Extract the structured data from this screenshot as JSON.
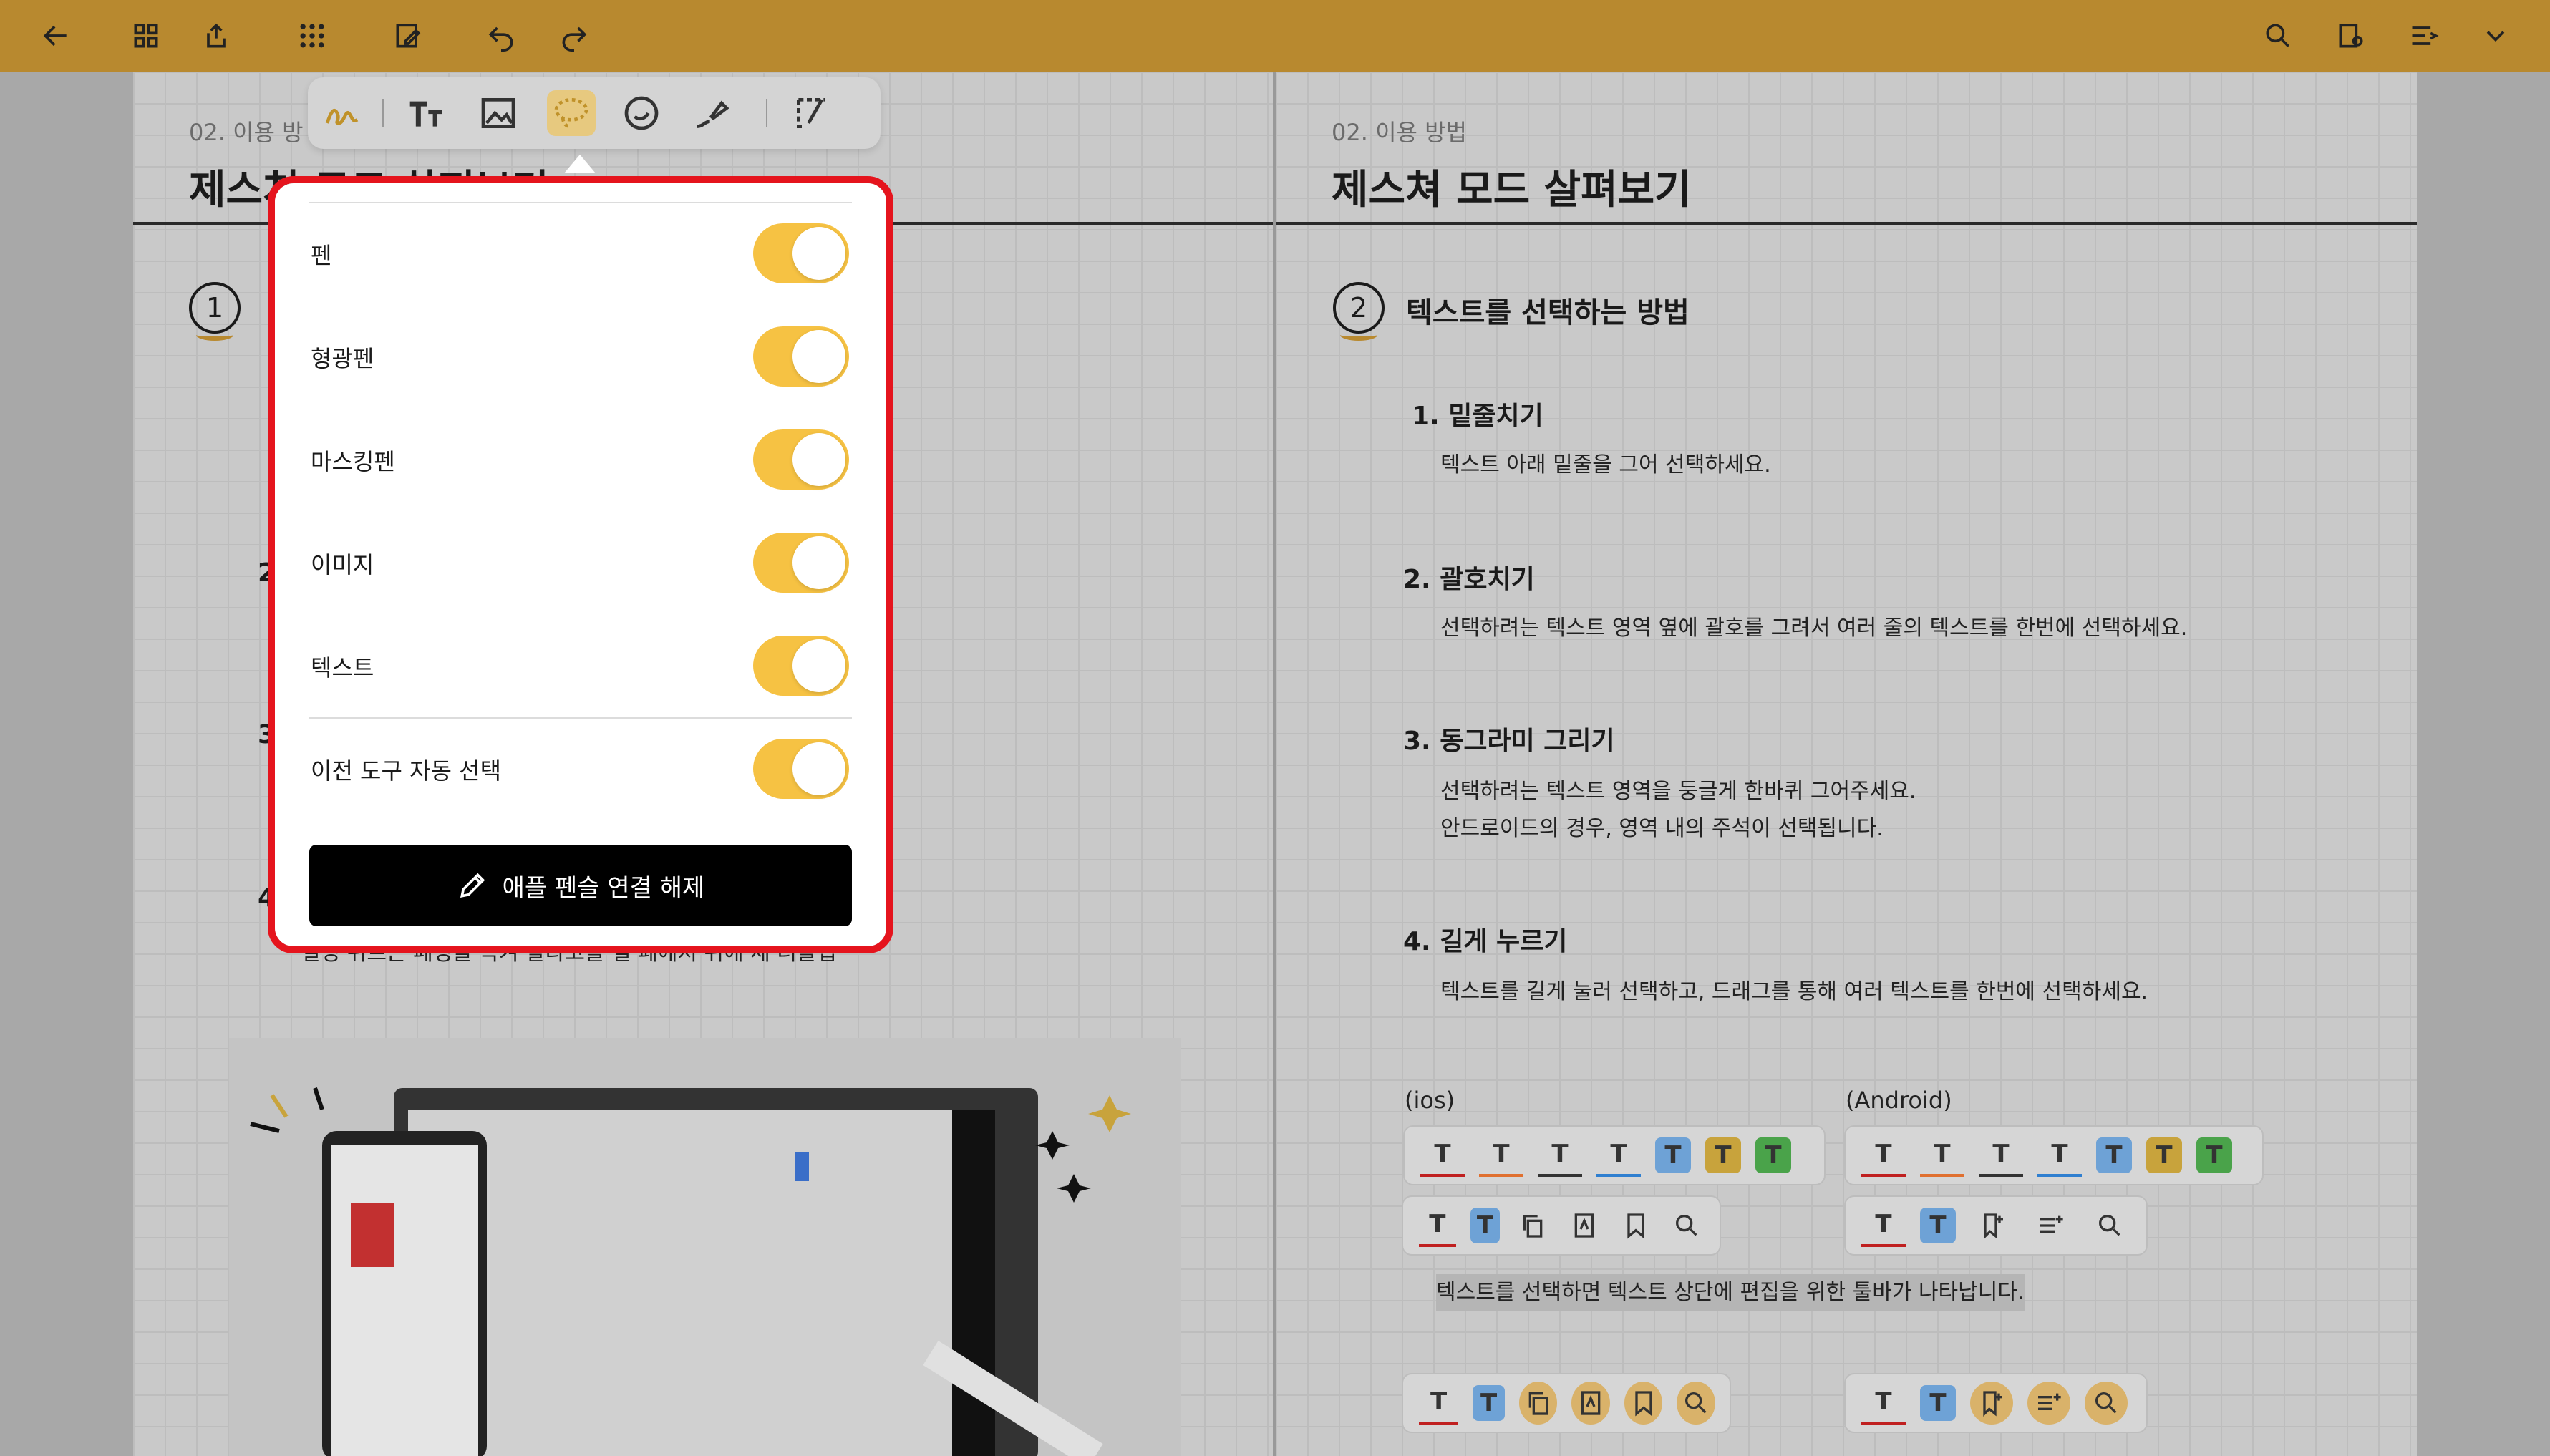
{
  "topbar": {
    "color": "#b8892f",
    "left_icons": [
      "back-arrow-icon",
      "grid-icon",
      "export-icon",
      "apps-icon",
      "edit-page-icon",
      "undo-icon",
      "redo-icon"
    ],
    "right_icons": [
      "search-icon",
      "page-settings-icon",
      "menu-icon",
      "chevron-down-icon"
    ]
  },
  "left_page": {
    "crumb": "02. 이용 방",
    "title": "제스처 모드 살펴보기",
    "circle_number": "1",
    "bg_numbers": [
      "2",
      "3",
      "4"
    ],
    "bottom_text": "결정 위르는 폐정을 녹겨 할라고를 될 폐에지 뒤에 세 더블탭"
  },
  "right_page": {
    "crumb": "02. 이용 방법",
    "title": "제스쳐 모드 살펴보기",
    "section_number": "2",
    "section_title": "텍스트를 선택하는 방법",
    "items": [
      {
        "heading": "1. 밑줄치기",
        "body": [
          "텍스트 아래 밑줄을 그어 선택하세요."
        ]
      },
      {
        "heading": "2. 괄호치기",
        "body": [
          "선택하려는 텍스트 영역 옆에 괄호를 그려서 여러 줄의 텍스트를 한번에 선택하세요."
        ]
      },
      {
        "heading": "3. 동그라미 그리기",
        "body": [
          "선택하려는 텍스트 영역을 둥글게 한바퀴 그어주세요.",
          "안드로이드의 경우, 영역 내의 주석이 선택됩니다."
        ]
      },
      {
        "heading": "4. 길게 누르기",
        "body": [
          "텍스트를 길게 눌러 선택하고, 드래그를 통해 여러 텍스트를 한번에 선택하세요."
        ]
      }
    ],
    "platform_ios": "(ios)",
    "platform_android": "(Android)",
    "toolbar_glyph": "T",
    "caption": "텍스트를 선택하면 텍스트 상단에 편집을 위한 툴바가 나타납니다."
  },
  "pen_toolbar": {
    "tools": [
      "pen-tool-icon",
      "text-tool-icon",
      "image-tool-icon",
      "lasso-tool-icon",
      "sticker-tool-icon",
      "eraser-tool-icon",
      "crop-tool-icon"
    ],
    "selected": "lasso-tool-icon"
  },
  "popup": {
    "toggles": [
      {
        "label": "펜",
        "on": true
      },
      {
        "label": "형광펜",
        "on": true
      },
      {
        "label": "마스킹펜",
        "on": true
      },
      {
        "label": "이미지",
        "on": true
      },
      {
        "label": "텍스트",
        "on": true
      },
      {
        "label": "이전 도구 자동 선택",
        "on": true
      }
    ],
    "disconnect_label": "애플 펜슬 연결 해제",
    "toggle_color": "#f6c243",
    "highlight_border_color": "#e5141d"
  }
}
